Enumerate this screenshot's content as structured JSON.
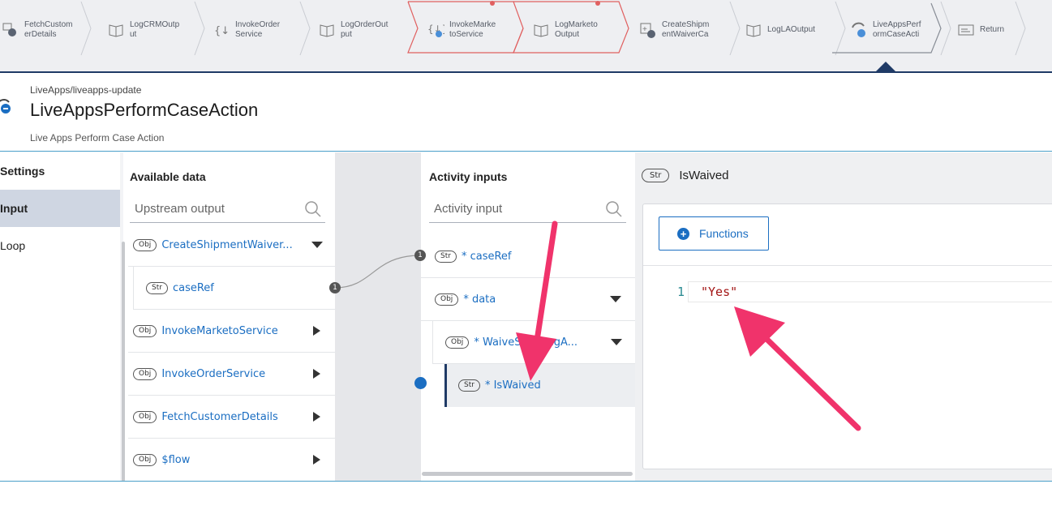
{
  "flow": {
    "steps": [
      {
        "label": "FetchCustom\nerDetails",
        "icon": "fetch-icon"
      },
      {
        "label": "LogCRMOutp\nut",
        "icon": "log-book-icon"
      },
      {
        "label": "InvokeOrder\nService",
        "icon": "invoke-icon"
      },
      {
        "label": "LogOrderOut\nput",
        "icon": "log-book-icon"
      },
      {
        "label": "InvokeMarke\ntoService",
        "icon": "invoke-icon"
      },
      {
        "label": "LogMarketo\nOutput",
        "icon": "log-book-icon"
      },
      {
        "label": "CreateShipm\nentWaiverCa",
        "icon": "create-icon"
      },
      {
        "label": "LogLAOutput",
        "icon": "log-book-icon"
      },
      {
        "label": "LiveAppsPerf\normCaseActi",
        "icon": "liveapps-icon"
      },
      {
        "label": "Return",
        "icon": "return-icon"
      }
    ],
    "error_color": "#e06060",
    "accent": "#1f3a66"
  },
  "header": {
    "breadcrumb": "LiveApps/liveapps-update",
    "title": "LiveAppsPerformCaseAction",
    "subtitle": "Live Apps Perform Case Action"
  },
  "tabs": [
    {
      "label": "Settings"
    },
    {
      "label": "Input"
    },
    {
      "label": "Loop"
    }
  ],
  "available": {
    "title": "Available data",
    "search_placeholder": "Upstream output",
    "items": [
      {
        "type": "Obj",
        "label": "CreateShipmentWaiver..."
      },
      {
        "type": "Str",
        "label": "caseRef",
        "count": "1"
      },
      {
        "type": "Obj",
        "label": "InvokeMarketoService"
      },
      {
        "type": "Obj",
        "label": "InvokeOrderService"
      },
      {
        "type": "Obj",
        "label": "FetchCustomerDetails"
      },
      {
        "type": "Obj",
        "label": "$flow"
      }
    ]
  },
  "activity": {
    "title": "Activity inputs",
    "search_placeholder": "Activity input",
    "items": [
      {
        "type": "Str",
        "label": "* caseRef",
        "count": "1"
      },
      {
        "type": "Obj",
        "label": "* data"
      },
      {
        "type": "Obj",
        "label": "* WaiveShippingA..."
      },
      {
        "type": "Str",
        "label": "* IsWaived"
      }
    ]
  },
  "mapper": {
    "field_type": "Str",
    "field_name": "IsWaived",
    "functions_label": "Functions",
    "line_number": "1",
    "expression": "\"Yes\""
  },
  "annotation_color": "#f0336b"
}
